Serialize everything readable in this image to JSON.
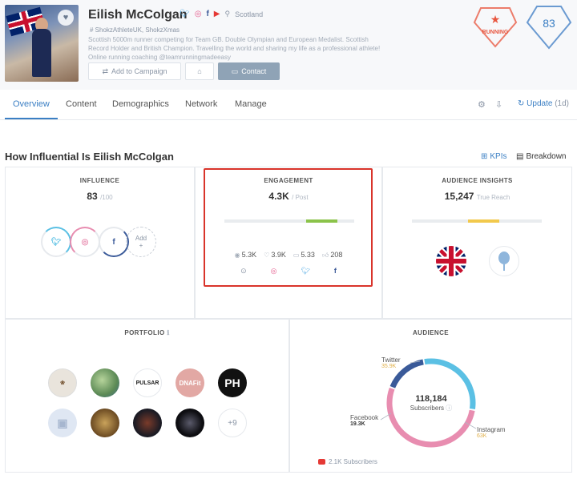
{
  "profile": {
    "name": "Eilish McColgan",
    "location": "Scotland",
    "handles": "ShokzAthleteUK, ShokzXmas",
    "bio": "Scottish 5000m runner competing for Team GB. Double Olympian and European Medalist. Scottish Record Holder and British Champion. Travelling the world and sharing my life as a professional athlete! Online running coaching @teamrunningmadeeasy",
    "add_to_campaign_label": "Add to Campaign",
    "contact_label": "Contact",
    "category_badge": "RUNNING",
    "score": "83"
  },
  "tabs": [
    {
      "label": "Overview"
    },
    {
      "label": "Content"
    },
    {
      "label": "Demographics"
    },
    {
      "label": "Network"
    },
    {
      "label": "Manage"
    }
  ],
  "update": {
    "label": "Update",
    "age": "(1d)"
  },
  "section": {
    "title": "How Influential Is Eilish McColgan",
    "kpis_label": "KPIs",
    "breakdown_label": "Breakdown"
  },
  "influence": {
    "title": "INFLUENCE",
    "value": "83",
    "suffix": "/100",
    "add_label": "Add",
    "add_plus": "+"
  },
  "engagement": {
    "title": "ENGAGEMENT",
    "value": "4.3K",
    "suffix": "/ Post",
    "level": 0.75,
    "views": "5.3K",
    "likes": "3.9K",
    "comments": "5.33",
    "shares": "208"
  },
  "audience_insights": {
    "title": "AUDIENCE INSIGHTS",
    "value": "15,247",
    "suffix": "True Reach",
    "level": 0.55
  },
  "portfolio": {
    "title": "PORTFOLIO",
    "items": [
      {
        "label": "",
        "color": "#e9e4dc"
      },
      {
        "label": "",
        "color": "#7fa46b"
      },
      {
        "label": "PULSAR",
        "color": "#ffffff"
      },
      {
        "label": "DNAFit",
        "color": "#e2a8a4"
      },
      {
        "label": "PH",
        "color": "#111111"
      },
      {
        "label": "",
        "color": "#dfe7f3"
      },
      {
        "label": "",
        "color": "#8a6a3a"
      },
      {
        "label": "",
        "color": "#1b1b24"
      },
      {
        "label": "",
        "color": "#0e0e12"
      }
    ],
    "more": "+9"
  },
  "audience": {
    "title": "AUDIENCE",
    "total": "118,184",
    "total_label": "Subscribers",
    "youtube_subs": "2.1K Subscribers",
    "segments": [
      {
        "name": "Twitter",
        "value": "35.9K",
        "amount": 35.9,
        "color": "#5bc0e4"
      },
      {
        "name": "Instagram",
        "value": "63K",
        "amount": 63,
        "color": "#e88db0"
      },
      {
        "name": "Facebook",
        "value": "19.3K",
        "amount": 19.3,
        "color": "#3a5a99"
      }
    ]
  },
  "colors": {
    "accent": "#3b7fc4",
    "highlight": "#d9342b",
    "engagement_bar": "#8bc34a",
    "insights_bar": "#f2c94c"
  }
}
